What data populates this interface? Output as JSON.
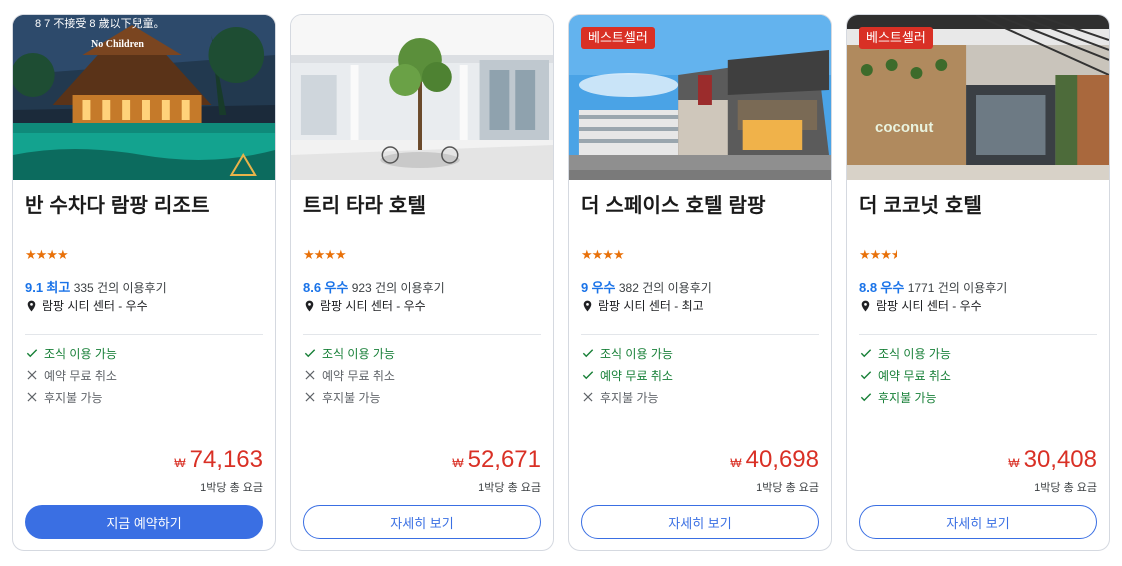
{
  "hotels": [
    {
      "name": "반 수차다 람팡 리조트",
      "badge": "",
      "photo_caption_1": "No Children",
      "photo_caption_2": "8 7 不接受 8 歲以下兒童。",
      "stars": "★★★★",
      "star_rating": 4,
      "score": "9.1",
      "score_label": "최고",
      "reviews": "335 건의 이용후기",
      "location": "람팡 시티 센터 - 우수",
      "features": [
        {
          "label": "조식 이용 가능",
          "available": true
        },
        {
          "label": "예약 무료 취소",
          "available": false
        },
        {
          "label": "후지불 가능",
          "available": false
        }
      ],
      "currency": "₩",
      "price": "74,163",
      "per_night": "1박당 총 요금",
      "button": "지금 예약하기",
      "button_style": "primary"
    },
    {
      "name": "트리 타라 호텔",
      "badge": "",
      "stars": "★★★★",
      "star_rating": 4,
      "score": "8.6",
      "score_label": "우수",
      "reviews": "923 건의 이용후기",
      "location": "람팡 시티 센터 - 우수",
      "features": [
        {
          "label": "조식 이용 가능",
          "available": true
        },
        {
          "label": "예약 무료 취소",
          "available": false
        },
        {
          "label": "후지불 가능",
          "available": false
        }
      ],
      "currency": "₩",
      "price": "52,671",
      "per_night": "1박당 총 요금",
      "button": "자세히 보기",
      "button_style": "outline"
    },
    {
      "name": "더 스페이스 호텔 람팡",
      "badge": "베스트셀러",
      "stars": "★★★★",
      "star_rating": 4,
      "score": "9",
      "score_label": "우수",
      "reviews": "382 건의 이용후기",
      "location": "람팡 시티 센터 - 최고",
      "features": [
        {
          "label": "조식 이용 가능",
          "available": true
        },
        {
          "label": "예약 무료 취소",
          "available": true
        },
        {
          "label": "후지불 가능",
          "available": false
        }
      ],
      "currency": "₩",
      "price": "40,698",
      "per_night": "1박당 총 요금",
      "button": "자세히 보기",
      "button_style": "outline"
    },
    {
      "name": "더 코코넛 호텔",
      "badge": "베스트셀러",
      "photo_caption_1": "coconut",
      "stars": "★★★",
      "star_rating": 3.5,
      "score": "8.8",
      "score_label": "우수",
      "reviews": "1771 건의 이용후기",
      "location": "람팡 시티 센터 - 우수",
      "features": [
        {
          "label": "조식 이용 가능",
          "available": true
        },
        {
          "label": "예약 무료 취소",
          "available": true
        },
        {
          "label": "후지불 가능",
          "available": true
        }
      ],
      "currency": "₩",
      "price": "30,408",
      "per_night": "1박당 총 요금",
      "button": "자세히 보기",
      "button_style": "outline"
    }
  ],
  "colors": {
    "accent": "#3a6fe3",
    "price": "#d93025",
    "badge": "#d93025",
    "star": "#e8710a",
    "available": "#188038",
    "unavailable": "#5f6368",
    "score": "#1a73e8"
  }
}
